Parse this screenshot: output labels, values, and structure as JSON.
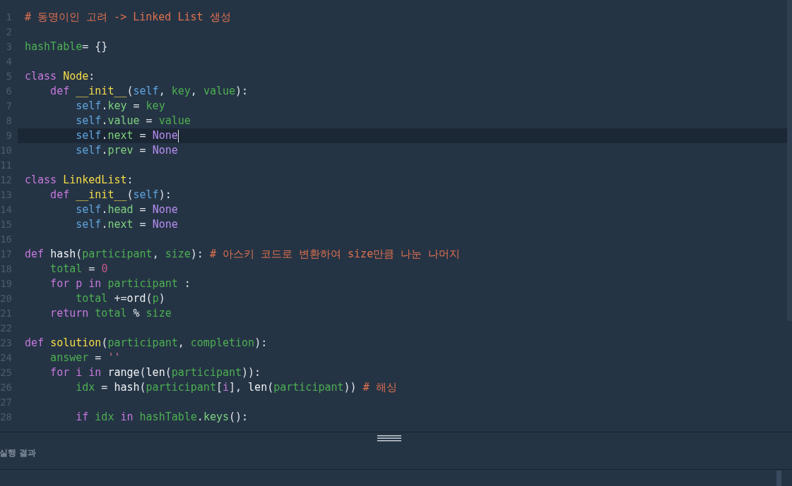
{
  "editor": {
    "lines": [
      {
        "number": "1",
        "current": false,
        "tokens": [
          {
            "kind": "comment",
            "text": "# 동명이인 고려 -> Linked List 생성"
          }
        ]
      },
      {
        "number": "2",
        "current": false
      },
      {
        "number": "3",
        "current": false,
        "tokens": [
          {
            "kind": "name",
            "text": "hashTable"
          },
          {
            "kind": "op",
            "text": "= {}"
          }
        ]
      },
      {
        "number": "4",
        "current": false
      },
      {
        "number": "5",
        "current": false,
        "tokens": [
          {
            "kind": "keyword",
            "text": "class "
          },
          {
            "kind": "type",
            "text": "Node"
          },
          {
            "kind": "op",
            "text": ":"
          }
        ]
      },
      {
        "number": "6",
        "current": false,
        "tokens": [
          {
            "kind": "keyword",
            "text": "    def "
          },
          {
            "kind": "type",
            "text": "__init__"
          },
          {
            "kind": "op",
            "text": "("
          },
          {
            "kind": "self",
            "text": "self"
          },
          {
            "kind": "op",
            "text": ", "
          },
          {
            "kind": "name",
            "text": "key"
          },
          {
            "kind": "op",
            "text": ", "
          },
          {
            "kind": "name",
            "text": "value"
          },
          {
            "kind": "op",
            "text": "):"
          }
        ]
      },
      {
        "number": "7",
        "current": false,
        "tokens": [
          {
            "kind": "self",
            "text": "        self"
          },
          {
            "kind": "op",
            "text": "."
          },
          {
            "kind": "attr",
            "text": "key"
          },
          {
            "kind": "op",
            "text": " = "
          },
          {
            "kind": "name",
            "text": "key"
          }
        ]
      },
      {
        "number": "8",
        "current": false,
        "tokens": [
          {
            "kind": "self",
            "text": "        self"
          },
          {
            "kind": "op",
            "text": "."
          },
          {
            "kind": "attr",
            "text": "value"
          },
          {
            "kind": "op",
            "text": " = "
          },
          {
            "kind": "name",
            "text": "value"
          }
        ]
      },
      {
        "number": "9",
        "current": true,
        "tokens": [
          {
            "kind": "self",
            "text": "        self"
          },
          {
            "kind": "op",
            "text": "."
          },
          {
            "kind": "attr",
            "text": "next"
          },
          {
            "kind": "op",
            "text": " = "
          },
          {
            "kind": "none",
            "text": "None"
          }
        ]
      },
      {
        "number": "10",
        "current": false,
        "tokens": [
          {
            "kind": "self",
            "text": "        self"
          },
          {
            "kind": "op",
            "text": "."
          },
          {
            "kind": "attr",
            "text": "prev"
          },
          {
            "kind": "op",
            "text": " = "
          },
          {
            "kind": "none",
            "text": "None"
          }
        ]
      },
      {
        "number": "11",
        "current": false
      },
      {
        "number": "12",
        "current": false,
        "tokens": [
          {
            "kind": "keyword",
            "text": "class "
          },
          {
            "kind": "type",
            "text": "LinkedList"
          },
          {
            "kind": "op",
            "text": ":"
          }
        ]
      },
      {
        "number": "13",
        "current": false,
        "tokens": [
          {
            "kind": "keyword",
            "text": "    def "
          },
          {
            "kind": "type",
            "text": "__init__"
          },
          {
            "kind": "op",
            "text": "("
          },
          {
            "kind": "self",
            "text": "self"
          },
          {
            "kind": "op",
            "text": "):"
          }
        ]
      },
      {
        "number": "14",
        "current": false,
        "tokens": [
          {
            "kind": "self",
            "text": "        self"
          },
          {
            "kind": "op",
            "text": "."
          },
          {
            "kind": "attr",
            "text": "head"
          },
          {
            "kind": "op",
            "text": " = "
          },
          {
            "kind": "none",
            "text": "None"
          }
        ]
      },
      {
        "number": "15",
        "current": false,
        "tokens": [
          {
            "kind": "self",
            "text": "        self"
          },
          {
            "kind": "op",
            "text": "."
          },
          {
            "kind": "attr",
            "text": "next"
          },
          {
            "kind": "op",
            "text": " = "
          },
          {
            "kind": "none",
            "text": "None"
          }
        ]
      },
      {
        "number": "16",
        "current": false
      },
      {
        "number": "17",
        "current": false,
        "tokens": [
          {
            "kind": "keyword",
            "text": "def "
          },
          {
            "kind": "call",
            "text": "hash"
          },
          {
            "kind": "op",
            "text": "("
          },
          {
            "kind": "name",
            "text": "participant"
          },
          {
            "kind": "op",
            "text": ", "
          },
          {
            "kind": "name",
            "text": "size"
          },
          {
            "kind": "op",
            "text": "): "
          },
          {
            "kind": "comment",
            "text": "# 아스키 코드로 변환하여 size만큼 나눈 나머지"
          }
        ]
      },
      {
        "number": "18",
        "current": false,
        "tokens": [
          {
            "kind": "name",
            "text": "    total"
          },
          {
            "kind": "op",
            "text": " = "
          },
          {
            "kind": "number",
            "text": "0"
          }
        ]
      },
      {
        "number": "19",
        "current": false,
        "tokens": [
          {
            "kind": "keyword",
            "text": "    for p in "
          },
          {
            "kind": "name",
            "text": "participant"
          },
          {
            "kind": "op",
            "text": " :"
          }
        ]
      },
      {
        "number": "20",
        "current": false,
        "tokens": [
          {
            "kind": "name",
            "text": "        total"
          },
          {
            "kind": "op",
            "text": " +="
          },
          {
            "kind": "call",
            "text": "ord"
          },
          {
            "kind": "op",
            "text": "("
          },
          {
            "kind": "name",
            "text": "p"
          },
          {
            "kind": "op",
            "text": ")"
          }
        ]
      },
      {
        "number": "21",
        "current": false,
        "tokens": [
          {
            "kind": "keyword",
            "text": "    return "
          },
          {
            "kind": "name",
            "text": "total"
          },
          {
            "kind": "op",
            "text": " % "
          },
          {
            "kind": "name",
            "text": "size"
          }
        ]
      },
      {
        "number": "22",
        "current": false
      },
      {
        "number": "23",
        "current": false,
        "tokens": [
          {
            "kind": "keyword",
            "text": "def "
          },
          {
            "kind": "type",
            "text": "solution"
          },
          {
            "kind": "op",
            "text": "("
          },
          {
            "kind": "name",
            "text": "participant"
          },
          {
            "kind": "op",
            "text": ", "
          },
          {
            "kind": "name",
            "text": "completion"
          },
          {
            "kind": "op",
            "text": "):"
          }
        ]
      },
      {
        "number": "24",
        "current": false,
        "tokens": [
          {
            "kind": "name",
            "text": "    answer"
          },
          {
            "kind": "op",
            "text": " = "
          },
          {
            "kind": "string",
            "text": "''"
          }
        ]
      },
      {
        "number": "25",
        "current": false,
        "tokens": [
          {
            "kind": "keyword",
            "text": "    for i in "
          },
          {
            "kind": "call",
            "text": "range"
          },
          {
            "kind": "op",
            "text": "("
          },
          {
            "kind": "call",
            "text": "len"
          },
          {
            "kind": "op",
            "text": "("
          },
          {
            "kind": "name",
            "text": "participant"
          },
          {
            "kind": "op",
            "text": ")):"
          }
        ]
      },
      {
        "number": "26",
        "current": false,
        "tokens": [
          {
            "kind": "name",
            "text": "        idx"
          },
          {
            "kind": "op",
            "text": " = "
          },
          {
            "kind": "call",
            "text": "hash"
          },
          {
            "kind": "op",
            "text": "("
          },
          {
            "kind": "name",
            "text": "participant"
          },
          {
            "kind": "op",
            "text": "["
          },
          {
            "kind": "keyword",
            "text": "i"
          },
          {
            "kind": "op",
            "text": "], "
          },
          {
            "kind": "call",
            "text": "len"
          },
          {
            "kind": "op",
            "text": "("
          },
          {
            "kind": "name",
            "text": "participant"
          },
          {
            "kind": "op",
            "text": ")) "
          },
          {
            "kind": "comment",
            "text": "# 해싱"
          }
        ]
      },
      {
        "number": "27",
        "current": false
      },
      {
        "number": "28",
        "current": false,
        "tokens": [
          {
            "kind": "keyword",
            "text": "        if "
          },
          {
            "kind": "name",
            "text": "idx"
          },
          {
            "kind": "keyword",
            "text": " in "
          },
          {
            "kind": "name",
            "text": "hashTable"
          },
          {
            "kind": "op",
            "text": "."
          },
          {
            "kind": "attr",
            "text": "keys"
          },
          {
            "kind": "op",
            "text": "():"
          }
        ]
      }
    ]
  },
  "output_panel": {
    "title": "실행 결과"
  }
}
